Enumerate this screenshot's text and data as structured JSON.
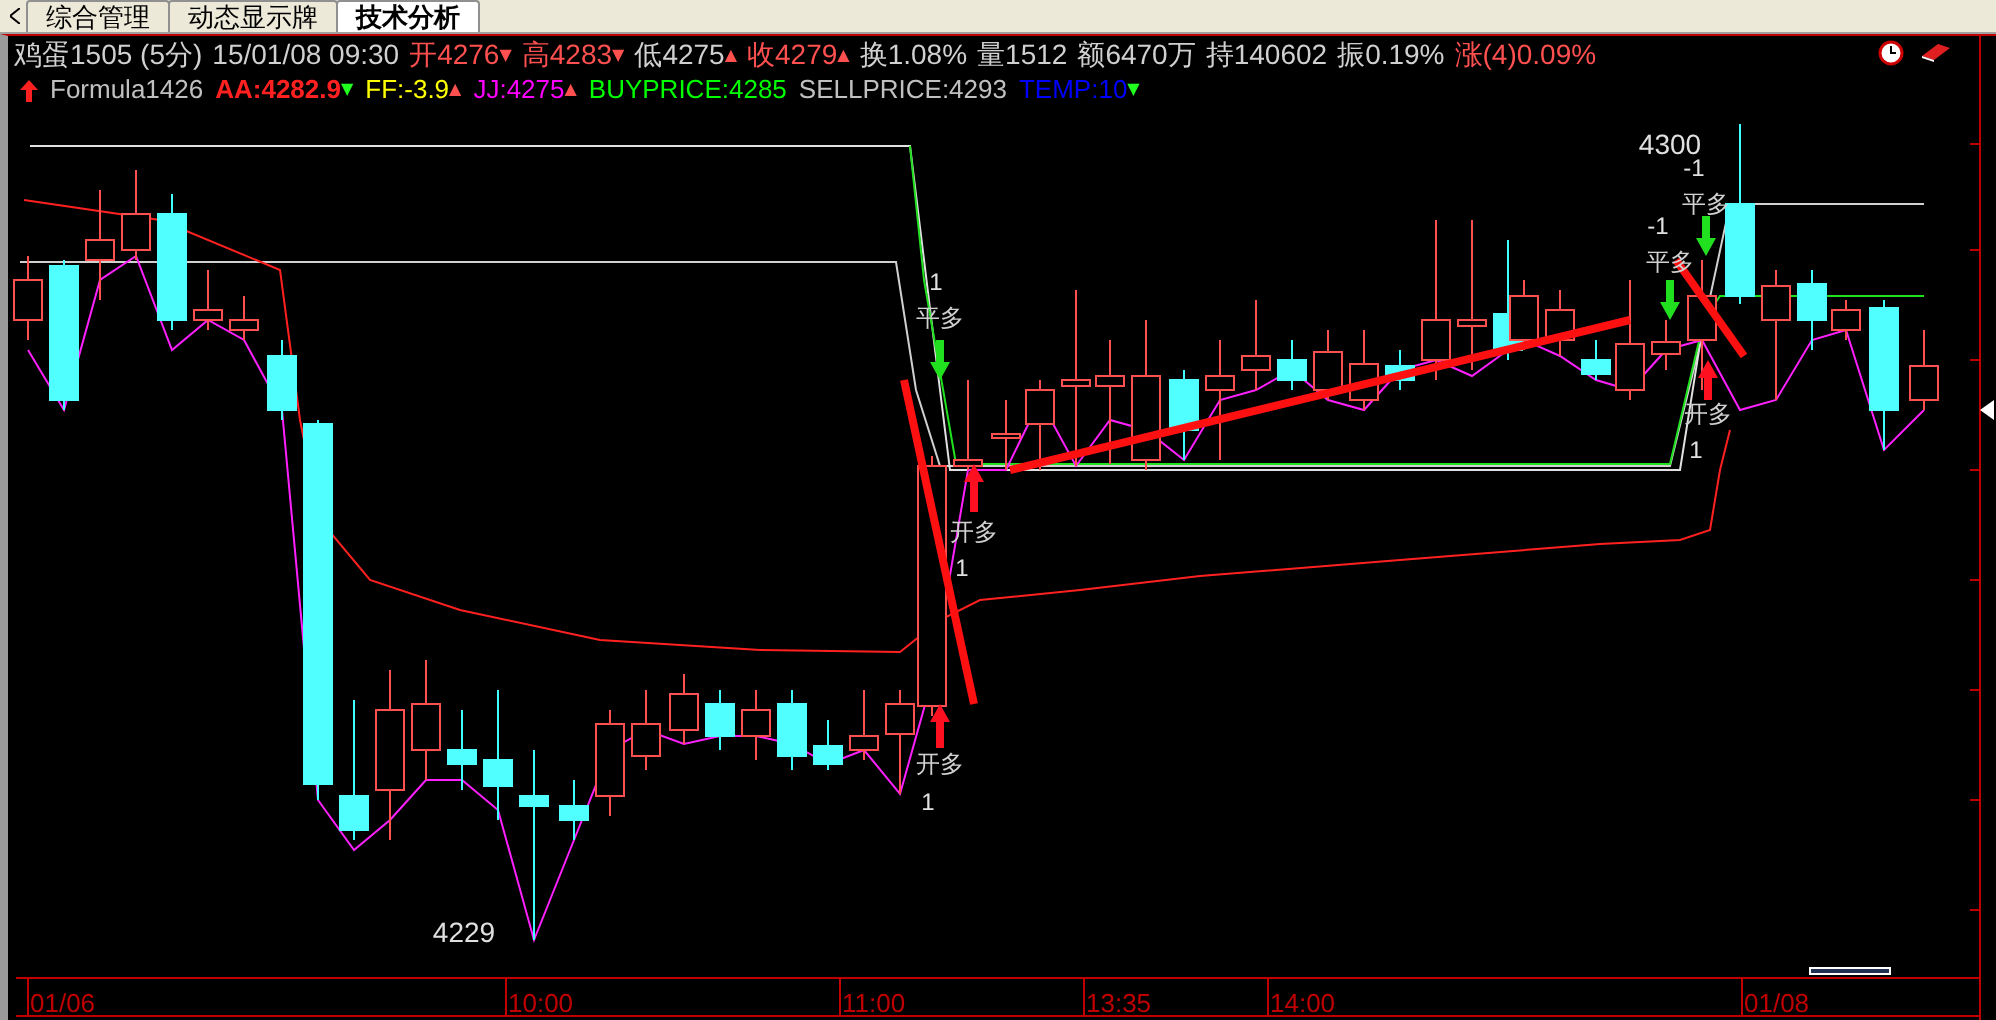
{
  "tabs": [
    {
      "label": "综合管理",
      "selected": false
    },
    {
      "label": "动态显示牌",
      "selected": false
    },
    {
      "label": "技术分析",
      "selected": true
    }
  ],
  "quote_line": [
    {
      "text": "鸡蛋1505 (5分)",
      "color": "#d0d0d0"
    },
    {
      "text": "15/01/08 09:30",
      "color": "#d0d0d0"
    },
    {
      "text": "开4276",
      "color": "#ff5050",
      "marker": {
        "symbol": "▼",
        "color": "#ff5050"
      }
    },
    {
      "text": "高4283",
      "color": "#ff5050",
      "marker": {
        "symbol": "▼",
        "color": "#ff5050"
      }
    },
    {
      "text": "低4275",
      "color": "#d0d0d0",
      "marker": {
        "symbol": "▲",
        "color": "#ff5050"
      }
    },
    {
      "text": "收4279",
      "color": "#ff5050",
      "marker": {
        "symbol": "▲",
        "color": "#ff5050"
      }
    },
    {
      "text": "换1.08%",
      "color": "#d0d0d0"
    },
    {
      "text": "量1512",
      "color": "#d0d0d0"
    },
    {
      "text": "额6470万",
      "color": "#d0d0d0"
    },
    {
      "text": "持140602",
      "color": "#d0d0d0"
    },
    {
      "text": "振0.19%",
      "color": "#d0d0d0"
    },
    {
      "text": "涨(4)0.09%",
      "color": "#ff5050"
    }
  ],
  "formula_line": [
    {
      "text": "Formula1426",
      "color": "#c0c0c0"
    },
    {
      "text": "AA:4282.9",
      "color": "#ff2020",
      "marker": {
        "symbol": "▼",
        "color": "#20ff20"
      }
    },
    {
      "text": "FF:-3.9",
      "color": "#ffff00",
      "marker": {
        "symbol": "▲",
        "color": "#ff5050"
      }
    },
    {
      "text": "JJ:4275",
      "color": "#ff00ff",
      "marker": {
        "symbol": "▲",
        "color": "#ff5050"
      }
    },
    {
      "text": "BUYPRICE:4285",
      "color": "#00ff00"
    },
    {
      "text": "SELLPRICE:4293",
      "color": "#c0c0c0"
    },
    {
      "text": "TEMP:10",
      "color": "#0000ff",
      "marker": {
        "symbol": "▼",
        "color": "#20ff20"
      }
    }
  ],
  "chart": {
    "price_labels": [
      "4300",
      "4229"
    ],
    "signals": [
      {
        "kind": "sell",
        "action": "平多",
        "quantity": "1"
      },
      {
        "kind": "buy",
        "action": "开多",
        "quantity": "1"
      },
      {
        "kind": "buy",
        "action": "开多",
        "quantity": "1"
      },
      {
        "kind": "sell",
        "action": "平多",
        "quantity": "-1"
      },
      {
        "kind": "sell",
        "action": "平多",
        "quantity": "-1"
      },
      {
        "kind": "buy",
        "action": "开多",
        "quantity": "1"
      }
    ],
    "x_labels": [
      "01/06",
      "10:00",
      "11:00",
      "13:35",
      "14:00",
      "01/08"
    ]
  }
}
